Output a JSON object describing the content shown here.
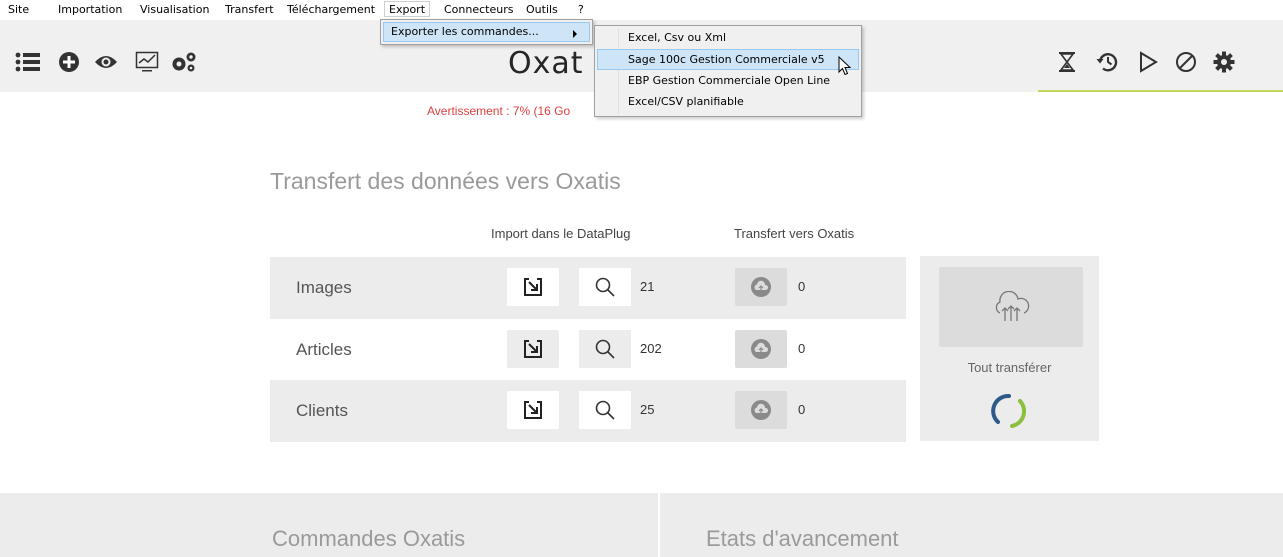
{
  "menubar": {
    "items": [
      "Site",
      "Importation",
      "Visualisation",
      "Transfert",
      "Téléchargement",
      "Export",
      "Connecteurs",
      "Outils",
      "?"
    ]
  },
  "export_submenu": {
    "item": "Exporter les commandes..."
  },
  "export_commandes_submenu": {
    "items": [
      "Excel, Csv ou Xml",
      "Sage 100c Gestion Commerciale v5",
      "EBP Gestion Commerciale Open Line",
      "Excel/CSV planifiable"
    ],
    "highlighted_index": 1
  },
  "toolbar": {
    "left_icons": [
      "list-icon",
      "add-circle-icon",
      "eye-icon",
      "monitor-chart-icon",
      "gears-icon"
    ],
    "right_icons": [
      "hourglass-icon",
      "history-icon",
      "play-icon",
      "cancel-icon",
      "settings-icon"
    ],
    "accent_color": "#c2d45a"
  },
  "logo": "Oxat",
  "warning": "Avertissement : 7% (16 Go",
  "transfer": {
    "title": "Transfert des données vers Oxatis",
    "col_import": "Import dans le DataPlug",
    "col_transfer": "Transfert vers Oxatis",
    "rows": [
      {
        "label": "Images",
        "count": "21",
        "transferred": "0"
      },
      {
        "label": "Articles",
        "count": "202",
        "transferred": "0"
      },
      {
        "label": "Clients",
        "count": "25",
        "transferred": "0"
      }
    ],
    "transfer_all_label": "Tout transférer"
  },
  "bottom": {
    "left_title": "Commandes Oxatis",
    "right_title": "Etats d'avancement"
  }
}
